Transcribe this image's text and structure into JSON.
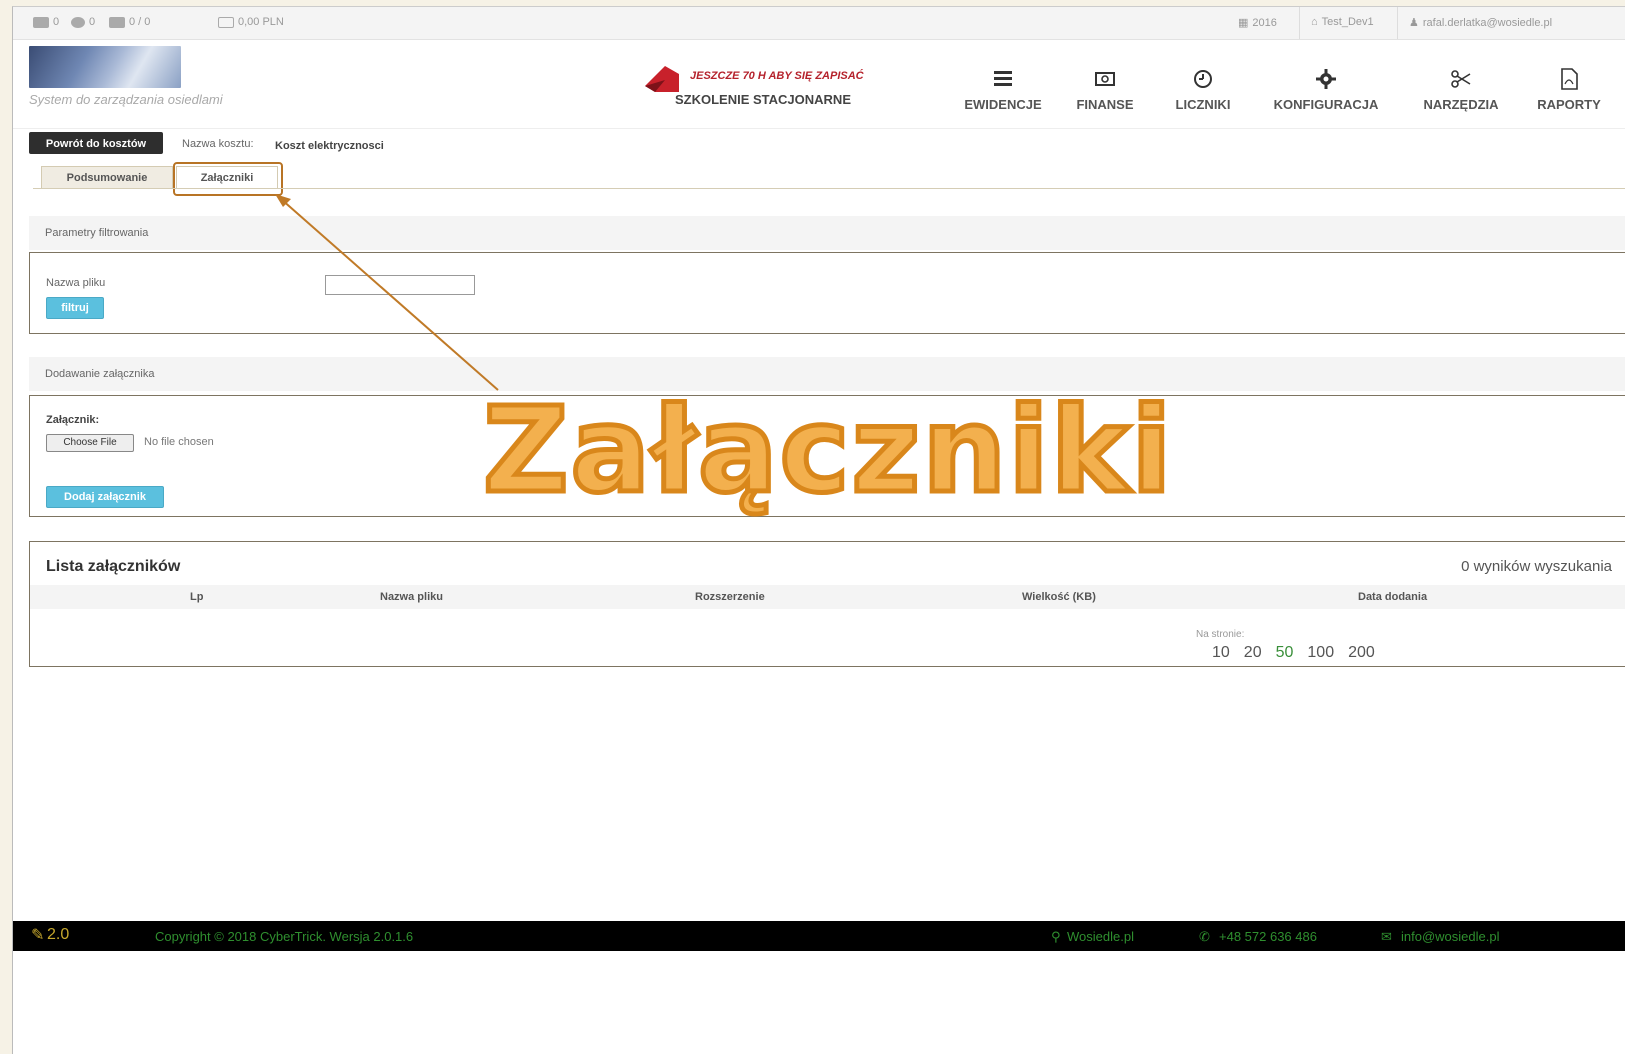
{
  "topbar": {
    "messages_count": "0",
    "comments_count": "0",
    "users_count": "0 / 0",
    "balance": "0,00 PLN",
    "year": "2016",
    "env": "Test_Dev1",
    "user": "rafal.derlatka@wosiedle.pl"
  },
  "header": {
    "subtitle": "System do zarządzania osiedlami",
    "promo_top": "JESZCZE 70 H ABY SIĘ ZAPISAĆ",
    "promo_bottom": "SZKOLENIE STACJONARNE",
    "nav": [
      {
        "label": "EWIDENCJE",
        "icon": "list-icon"
      },
      {
        "label": "FINANSE",
        "icon": "money-icon"
      },
      {
        "label": "LICZNIKI",
        "icon": "clock-icon"
      },
      {
        "label": "KONFIGURACJA",
        "icon": "gear-icon"
      },
      {
        "label": "NARZĘDZIA",
        "icon": "scissors-icon"
      },
      {
        "label": "RAPORTY",
        "icon": "pdf-icon"
      }
    ]
  },
  "toolbar": {
    "back_label": "Powrót do kosztów",
    "cost_label": "Nazwa kosztu:",
    "cost_value": "Koszt elektrycznosci"
  },
  "tabs": [
    "Podsumowanie",
    "Załączniki"
  ],
  "filter": {
    "title": "Parametry filtrowania",
    "file_name_label": "Nazwa pliku",
    "file_name_value": "",
    "filter_button": "filtruj"
  },
  "upload": {
    "title": "Dodawanie załącznika",
    "attachment_label": "Załącznik:",
    "choose_file": "Choose File",
    "no_file": "No file chosen",
    "add_button": "Dodaj załącznik"
  },
  "list": {
    "title": "Lista załączników",
    "results": "0 wyników wyszukania",
    "columns": [
      "Lp",
      "Nazwa pliku",
      "Rozszerzenie",
      "Wielkość (KB)",
      "Data dodania"
    ],
    "per_page_label": "Na stronie:",
    "per_page_options": [
      "10",
      "20",
      "50",
      "100",
      "200"
    ],
    "per_page_selected": "50"
  },
  "overlay_title": "Załączniki",
  "footer": {
    "version": "2.0",
    "copyright": "Copyright © 2018 CyberTrick. Wersja 2.0.1.6",
    "site": "Wosiedle.pl",
    "phone": "+48 572 636 486",
    "email": "info@wosiedle.pl"
  },
  "colors": {
    "accent_orange": "#d9871b",
    "button_blue": "#5bc0de",
    "footer_green": "#2f8f2f"
  }
}
